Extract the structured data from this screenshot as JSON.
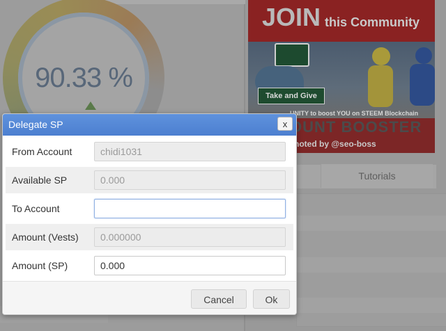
{
  "background": {
    "gauge": {
      "value": "90.33 %"
    },
    "banner": {
      "headline_big": "JOIN",
      "headline_small": "this Community",
      "take_give": "Take and Give",
      "tagline": "UNITY to boost YOU on STEEM Blockchain",
      "booster": "OUNT BOOSTER",
      "promoted": "noted by @seo-boss"
    },
    "tabs": {
      "tutorials": "Tutorials"
    }
  },
  "dialog": {
    "title": "Delegate SP",
    "close_label": "x",
    "fields": [
      {
        "label": "From Account",
        "value": "chidi1031"
      },
      {
        "label": "Available SP",
        "value": "0.000"
      },
      {
        "label": "To Account",
        "value": ""
      },
      {
        "label": "Amount (Vests)",
        "value": "0.000000"
      },
      {
        "label": "Amount (SP)",
        "value": "0.000"
      }
    ],
    "buttons": {
      "cancel": "Cancel",
      "ok": "Ok"
    }
  },
  "colors": {
    "titlebar": "#4c7fd0",
    "overlay": "#8f8f8f"
  }
}
